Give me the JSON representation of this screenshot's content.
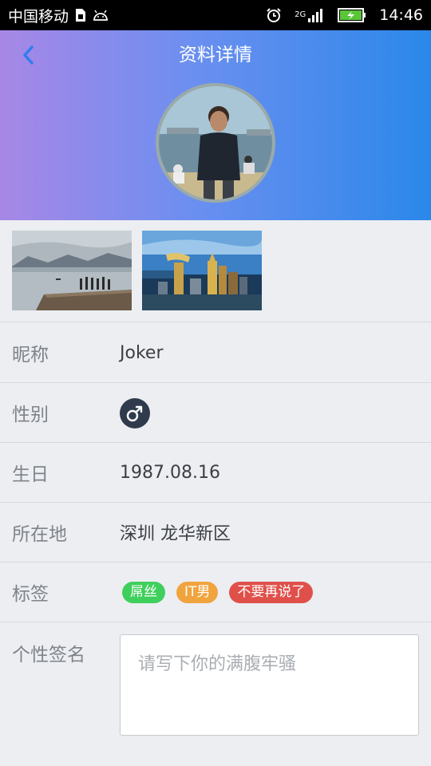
{
  "status_bar": {
    "carrier": "中国移动",
    "network": "2G",
    "time": "14:46"
  },
  "header": {
    "title": "资料详情"
  },
  "photos": [
    {
      "name": "photo-lake-pier"
    },
    {
      "name": "photo-city-skyline"
    }
  ],
  "profile": {
    "nickname": {
      "label": "昵称",
      "value": "Joker"
    },
    "gender": {
      "label": "性别",
      "icon": "male-icon"
    },
    "birthday": {
      "label": "生日",
      "value": "1987.08.16"
    },
    "location": {
      "label": "所在地",
      "value": "深圳 龙华新区"
    },
    "tags": {
      "label": "标签",
      "items": [
        {
          "text": "屌丝",
          "color": "#3fcf5c"
        },
        {
          "text": "IT男",
          "color": "#f0a43e"
        },
        {
          "text": "不要再说了",
          "color": "#e0504a"
        }
      ]
    },
    "signature": {
      "label": "个性签名",
      "placeholder": "请写下你的满腹牢骚",
      "value": ""
    }
  },
  "colors": {
    "header_start": "#a887e6",
    "header_end": "#2a88ea",
    "back_arrow": "#2f7ef0"
  }
}
